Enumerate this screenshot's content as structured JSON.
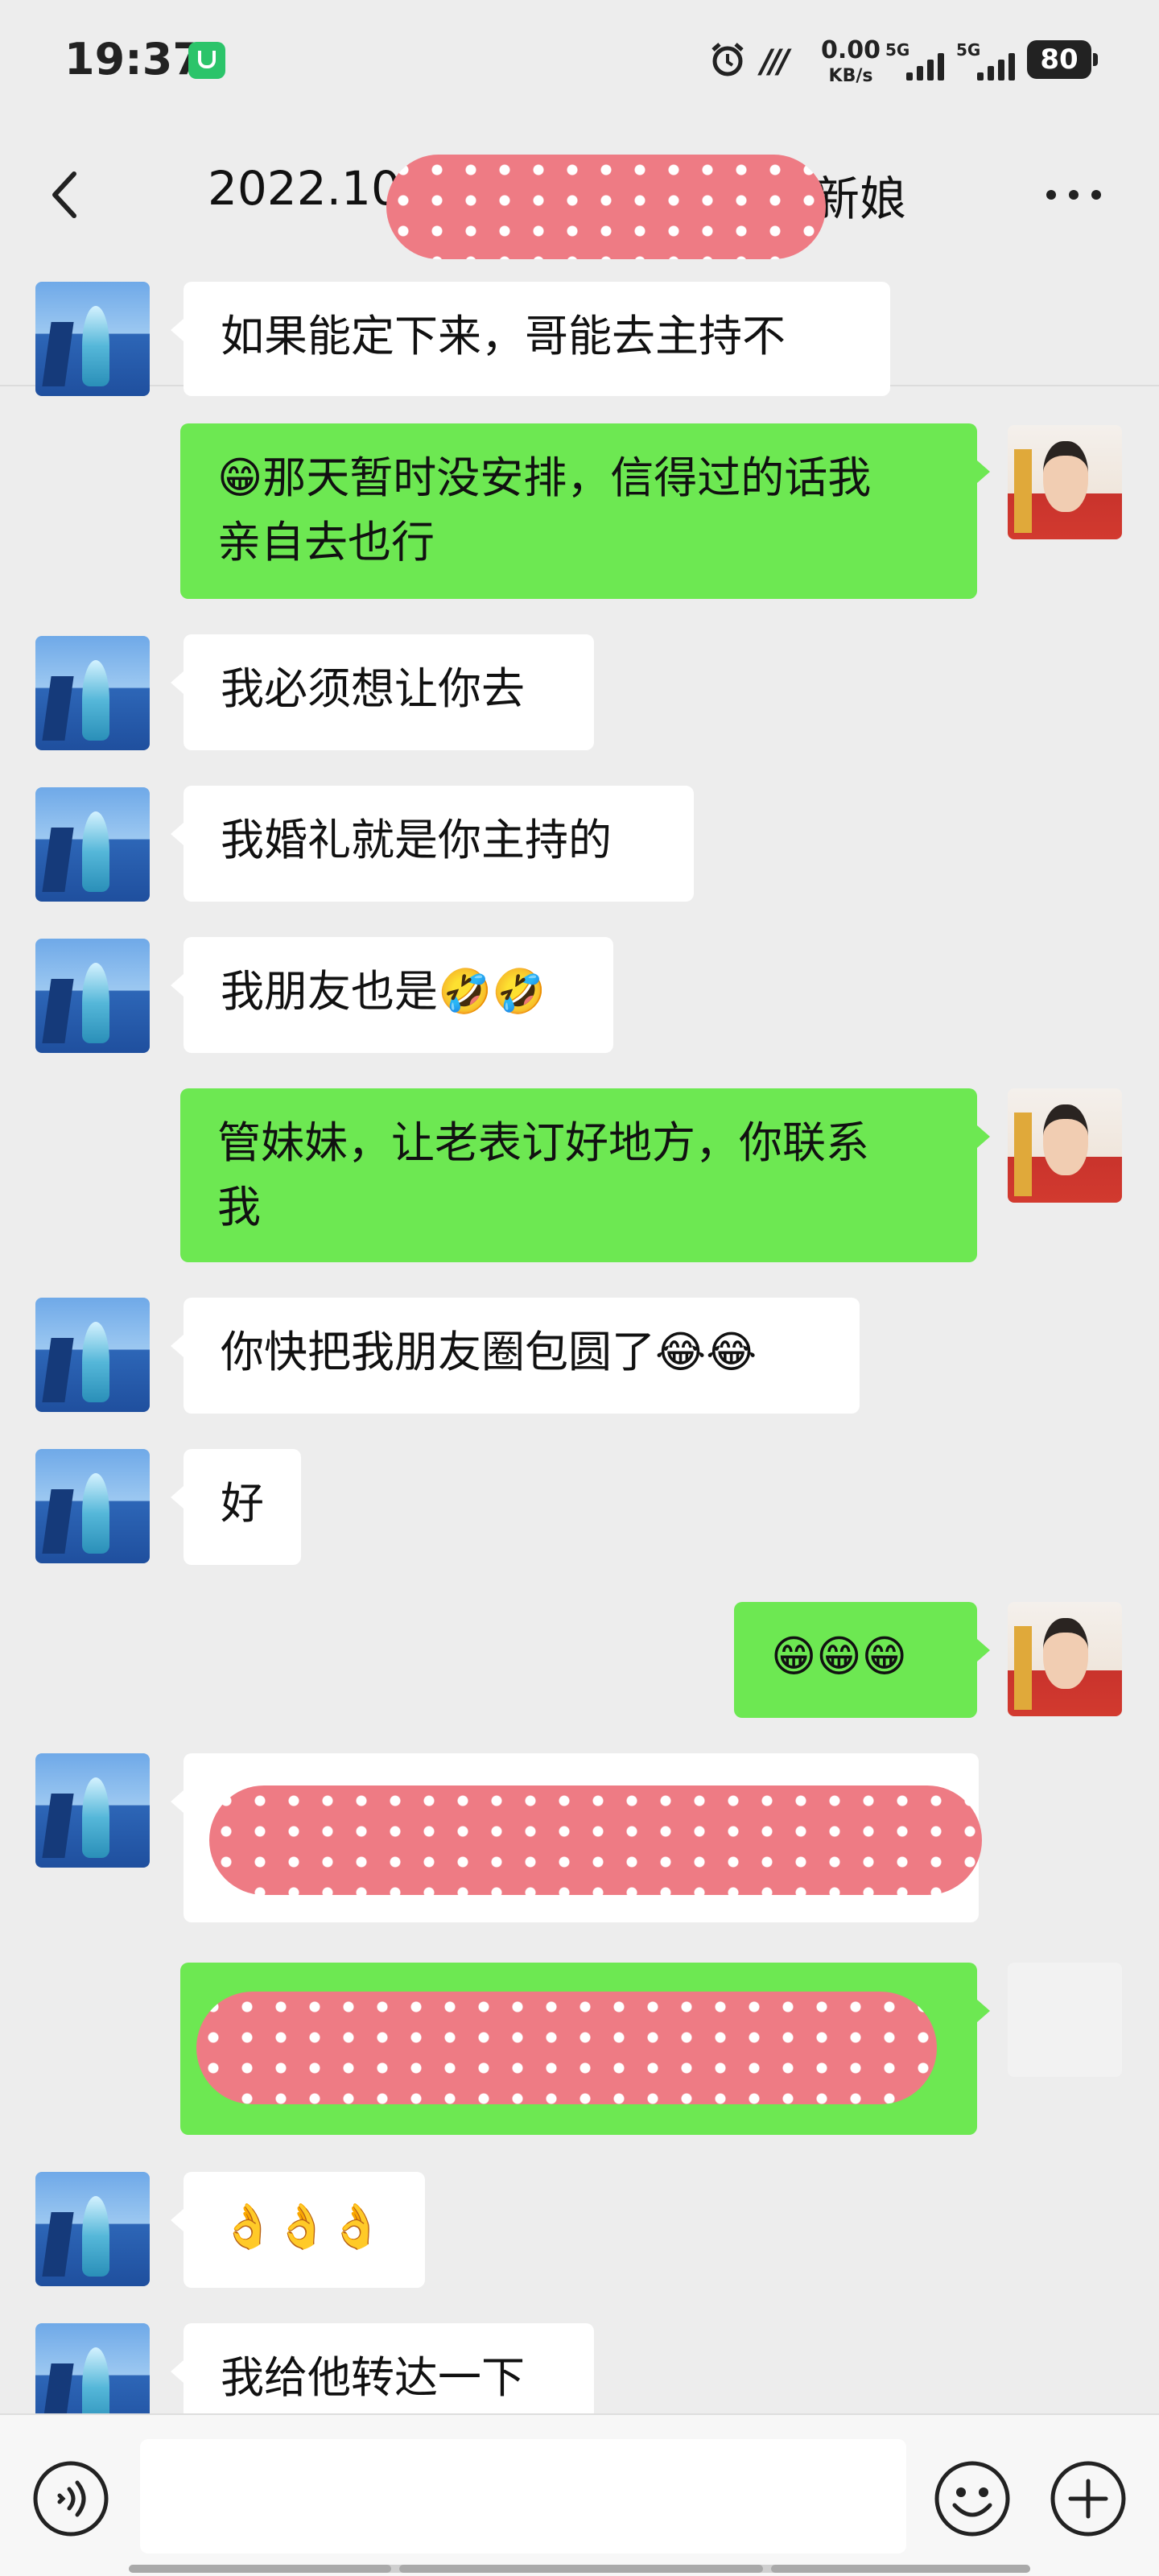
{
  "status": {
    "time": "19:37",
    "speed_value": "0.00",
    "speed_unit": "KB/s",
    "sim1_label": "5G",
    "sim2_label": "5G",
    "battery": "80"
  },
  "header": {
    "title_prefix": "2022.10",
    "title_suffix": "新娘",
    "title_redacted": true,
    "back_icon": "chevron-left-icon",
    "more_icon": "more-dots-icon"
  },
  "messages": [
    {
      "side": "in",
      "text": "如果能定下来，哥能去主持不"
    },
    {
      "side": "out",
      "text": "😁那天暂时没安排，信得过的话我\n亲自去也行"
    },
    {
      "side": "in",
      "text": "我必须想让你去"
    },
    {
      "side": "in",
      "text": "我婚礼就是你主持的"
    },
    {
      "side": "in",
      "text": "我朋友也是🤣🤣"
    },
    {
      "side": "out",
      "text": "管妹妹，让老表订好地方，你联系\n我"
    },
    {
      "side": "in",
      "text": "你快把我朋友圈包圆了😂😂"
    },
    {
      "side": "in",
      "text": "好"
    },
    {
      "side": "out",
      "text": "😁😁😁"
    },
    {
      "side": "in",
      "text": "",
      "redacted": true
    },
    {
      "side": "out",
      "text": "",
      "redacted": true
    },
    {
      "side": "in",
      "text": "👌👌👌"
    },
    {
      "side": "in",
      "text": "我给他转达一下"
    }
  ],
  "input": {
    "placeholder": "",
    "voice_icon": "voice-icon",
    "emoji_icon": "emoji-icon",
    "plus_icon": "plus-icon"
  },
  "colors": {
    "background": "#ededed",
    "bubble_out": "#6de852",
    "bubble_in": "#ffffff",
    "redaction": "#ee7b84"
  }
}
